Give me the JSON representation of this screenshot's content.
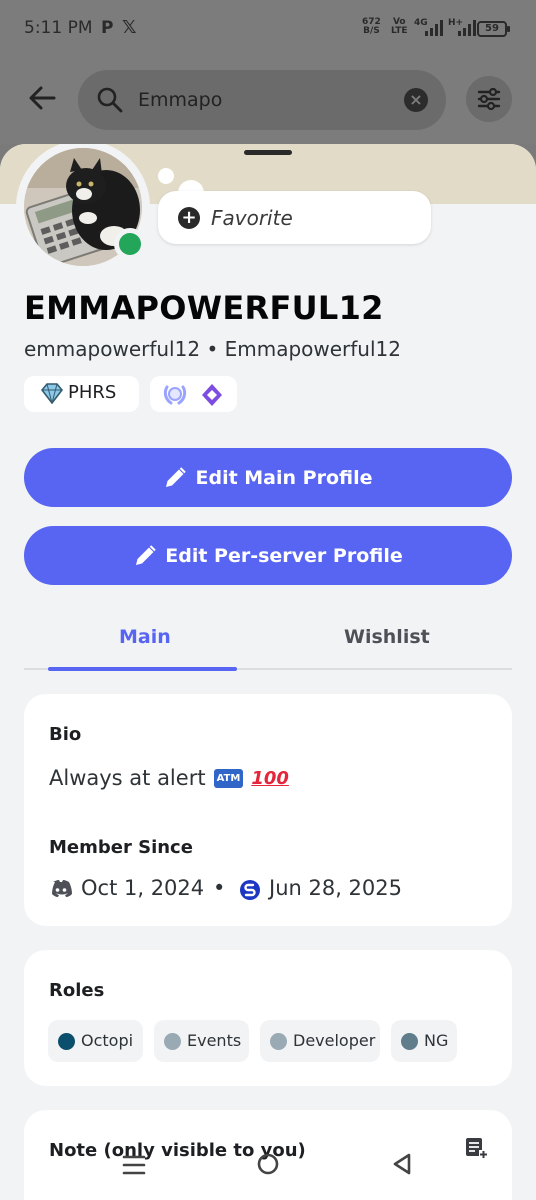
{
  "status_bar": {
    "time": "5:11 PM",
    "net_speed_value": "672",
    "net_speed_unit": "B/S",
    "volte_top": "Vo",
    "volte_bottom": "LTE",
    "network_1": "4G",
    "network_2": "H+",
    "battery": "59"
  },
  "search": {
    "query": "Emmapo"
  },
  "profile": {
    "favorite_label": "Favorite",
    "display_name": "EMMAPOWERFUL12",
    "username": "emmapowerful12",
    "separator": "•",
    "global_name": "Emmapowerful12",
    "clan_tag": "PHRS",
    "online_status_color": "#23a55a"
  },
  "buttons": {
    "edit_main": "Edit Main Profile",
    "edit_server": "Edit Per-server Profile"
  },
  "tabs": [
    {
      "label": "Main",
      "active": true
    },
    {
      "label": "Wishlist",
      "active": false
    }
  ],
  "bio": {
    "heading": "Bio",
    "text": "Always at alert",
    "atm_emoji": "ATM",
    "hundred_emoji": "100"
  },
  "member_since": {
    "heading": "Member Since",
    "discord_date": "Oct 1, 2024",
    "dot": "•",
    "server_date": "Jun 28, 2025"
  },
  "roles": {
    "heading": "Roles",
    "items": [
      {
        "name": "Octopi",
        "color": "#0b4f6c"
      },
      {
        "name": "Events",
        "color": "#99aab5"
      },
      {
        "name": "Developer",
        "color": "#99aab5"
      },
      {
        "name": "NG",
        "color": "#607d8b"
      }
    ]
  },
  "note": {
    "heading": "Note (only visible to you)"
  },
  "colors": {
    "accent": "#5865f2",
    "banner": "#e2dbc7"
  }
}
